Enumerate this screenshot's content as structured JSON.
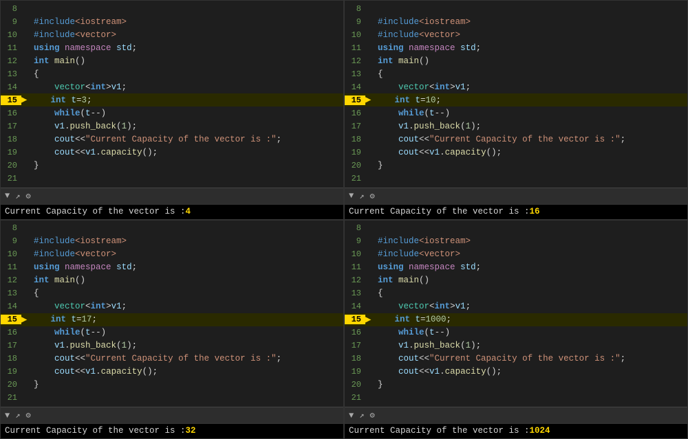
{
  "panels": [
    {
      "id": "panel-tl",
      "highlighted_line": 15,
      "t_value": "3",
      "output_prefix": "Current Capacity of the vector is :",
      "output_value": "4",
      "lines": [
        {
          "num": 8,
          "content": ""
        },
        {
          "num": 9,
          "content": "#include<iostream>"
        },
        {
          "num": 10,
          "content": "#include<vector>"
        },
        {
          "num": 11,
          "content": "using namespace std;"
        },
        {
          "num": 12,
          "content": "int main()"
        },
        {
          "num": 13,
          "content": "{"
        },
        {
          "num": 14,
          "content": "    vector<int>v1;"
        },
        {
          "num": 15,
          "content": "    int t=3;",
          "arrow": true
        },
        {
          "num": 16,
          "content": "    while(t--)"
        },
        {
          "num": 17,
          "content": "    v1.push_back(1);"
        },
        {
          "num": 18,
          "content": "    cout<<\"Current Capacity of the vector is :\";"
        },
        {
          "num": 19,
          "content": "    cout<<v1.capacity();"
        },
        {
          "num": 20,
          "content": "}"
        },
        {
          "num": 21,
          "content": ""
        }
      ]
    },
    {
      "id": "panel-tr",
      "highlighted_line": 15,
      "t_value": "10",
      "output_prefix": "Current Capacity of the vector is :",
      "output_value": "16",
      "lines": [
        {
          "num": 8,
          "content": ""
        },
        {
          "num": 9,
          "content": "#include<iostream>"
        },
        {
          "num": 10,
          "content": "#include<vector>"
        },
        {
          "num": 11,
          "content": "using namespace std;"
        },
        {
          "num": 12,
          "content": "int main()"
        },
        {
          "num": 13,
          "content": "{"
        },
        {
          "num": 14,
          "content": "    vector<int>v1;"
        },
        {
          "num": 15,
          "content": "    int t=10;",
          "arrow": true
        },
        {
          "num": 16,
          "content": "    while(t--)"
        },
        {
          "num": 17,
          "content": "    v1.push_back(1);"
        },
        {
          "num": 18,
          "content": "    cout<<\"Current Capacity of the vector is :\";"
        },
        {
          "num": 19,
          "content": "    cout<<v1.capacity();"
        },
        {
          "num": 20,
          "content": "}"
        },
        {
          "num": 21,
          "content": ""
        }
      ]
    },
    {
      "id": "panel-bl",
      "highlighted_line": 15,
      "t_value": "17",
      "output_prefix": "Current Capacity of the vector is :",
      "output_value": "32",
      "lines": [
        {
          "num": 8,
          "content": ""
        },
        {
          "num": 9,
          "content": "#include<iostream>"
        },
        {
          "num": 10,
          "content": "#include<vector>"
        },
        {
          "num": 11,
          "content": "using namespace std;"
        },
        {
          "num": 12,
          "content": "int main()"
        },
        {
          "num": 13,
          "content": "{"
        },
        {
          "num": 14,
          "content": "    vector<int>v1;"
        },
        {
          "num": 15,
          "content": "    int t=17;",
          "arrow": true
        },
        {
          "num": 16,
          "content": "    while(t--)"
        },
        {
          "num": 17,
          "content": "    v1.push_back(1);"
        },
        {
          "num": 18,
          "content": "    cout<<\"Current Capacity of the vector is :\";"
        },
        {
          "num": 19,
          "content": "    cout<<v1.capacity();"
        },
        {
          "num": 20,
          "content": "}"
        },
        {
          "num": 21,
          "content": ""
        }
      ]
    },
    {
      "id": "panel-br",
      "highlighted_line": 15,
      "t_value": "1000",
      "output_prefix": "Current Capacity of the vector is :",
      "output_value": "1024",
      "lines": [
        {
          "num": 8,
          "content": ""
        },
        {
          "num": 9,
          "content": "#include<iostream>"
        },
        {
          "num": 10,
          "content": "#include<vector>"
        },
        {
          "num": 11,
          "content": "using namespace std;"
        },
        {
          "num": 12,
          "content": "int main()"
        },
        {
          "num": 13,
          "content": "{"
        },
        {
          "num": 14,
          "content": "    vector<int>v1;"
        },
        {
          "num": 15,
          "content": "    int t=1000;",
          "arrow": true
        },
        {
          "num": 16,
          "content": "    while(t--)"
        },
        {
          "num": 17,
          "content": "    v1.push_back(1);"
        },
        {
          "num": 18,
          "content": "    cout<<\"Current Capacity of the vector is :\";"
        },
        {
          "num": 19,
          "content": "    cout<<v1.capacity();"
        },
        {
          "num": 20,
          "content": "}"
        },
        {
          "num": 21,
          "content": ""
        }
      ]
    }
  ],
  "toolbar": {
    "icons": [
      "▼",
      "↗",
      "⚙"
    ]
  }
}
